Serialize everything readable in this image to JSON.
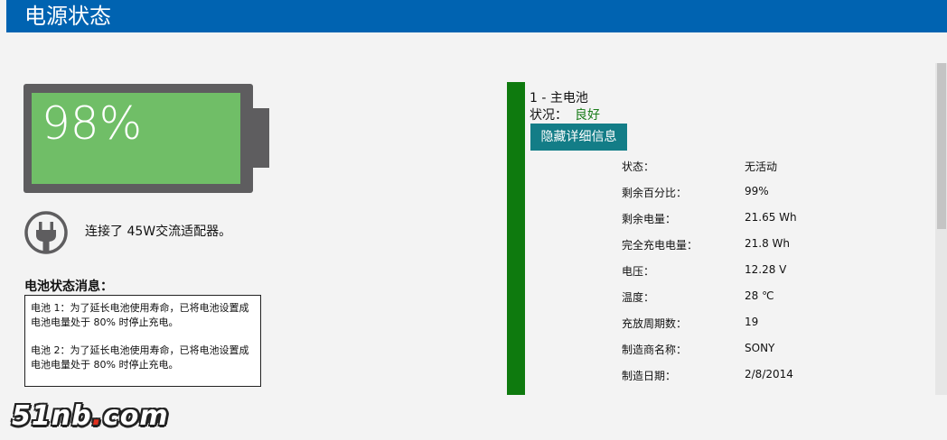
{
  "window": {
    "title": "电源状态"
  },
  "battery_graphic": {
    "percent_label": "98%",
    "charge_fraction": 0.98
  },
  "adapter": {
    "text": "连接了 45W交流适配器。"
  },
  "messages": {
    "heading": "电池状态消息：",
    "items": [
      "电池 1：为了延长电池使用寿命，已将电池设置成电池电量处于 80% 时停止充电。",
      "电池 2：为了延长电池使用寿命，已将电池设置成电池电量处于 80% 时停止充电。"
    ]
  },
  "battery_detail": {
    "name": "1 - 主电池",
    "condition_label": "状况：",
    "condition_value": "良好",
    "hide_button": "隐藏详细信息",
    "rows": [
      {
        "label": "状态：",
        "value": "无活动"
      },
      {
        "label": "剩余百分比：",
        "value": "99%"
      },
      {
        "label": "剩余电量：",
        "value": "21.65 Wh"
      },
      {
        "label": "完全充电电量：",
        "value": "21.8 Wh"
      },
      {
        "label": "电压：",
        "value": "12.28 V"
      },
      {
        "label": "温度：",
        "value": "28 ℃"
      },
      {
        "label": "充放周期数：",
        "value": "19"
      },
      {
        "label": "制造商名称：",
        "value": "SONY"
      },
      {
        "label": "制造日期：",
        "value": "2/8/2014"
      }
    ]
  },
  "watermark": {
    "text_main": "51nb",
    "text_dot": ".",
    "text_end": "com"
  },
  "colors": {
    "titlebar": "#0063b1",
    "battery_fill": "#70be67",
    "battery_body": "#5e5d5f",
    "green_bar": "#0e7a0e",
    "condition_good": "#1a7d1a",
    "button": "#137d87"
  },
  "icons": {
    "plug": "power-plug-icon"
  }
}
